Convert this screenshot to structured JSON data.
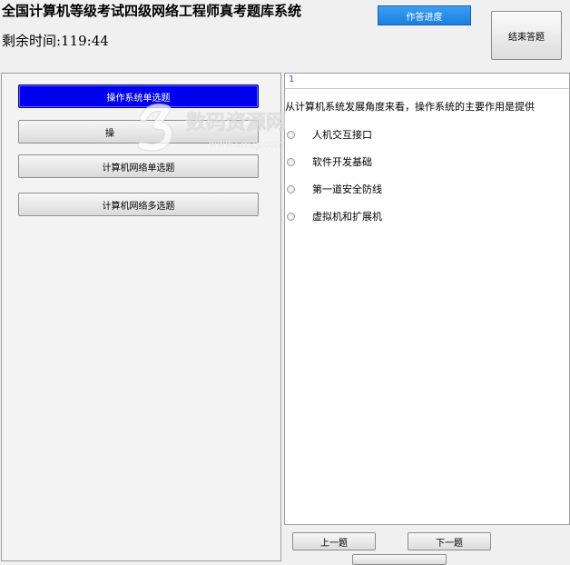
{
  "app": {
    "title": "全国计算机等级考试四级网络工程师真考题库系统",
    "timer_label": "剩余时间:119:44"
  },
  "header": {
    "progress_label": "作答进度",
    "end_label": "结束答题"
  },
  "categories": [
    {
      "label": "操作系统单选题",
      "active": true
    },
    {
      "label": "操",
      "active": false
    },
    {
      "label": "计算机网络单选题",
      "active": false
    },
    {
      "label": "计算机网络多选题",
      "active": false
    }
  ],
  "question": {
    "number": "1",
    "text": "从计算机系统发展角度来看，操作系统的主要作用是提供",
    "options": [
      {
        "label": "人机交互接口"
      },
      {
        "label": "软件开发基础"
      },
      {
        "label": "第一道安全防线"
      },
      {
        "label": "虚拟机和扩展机"
      }
    ]
  },
  "nav": {
    "prev_label": "上一题",
    "next_label": "下一题"
  },
  "watermark": {
    "brand": "数码资源网",
    "url": "www.smzy.com"
  },
  "colors": {
    "active_category": "#0000f0",
    "progress_button": "#2b8fe8",
    "watermark": "#ffffff"
  }
}
